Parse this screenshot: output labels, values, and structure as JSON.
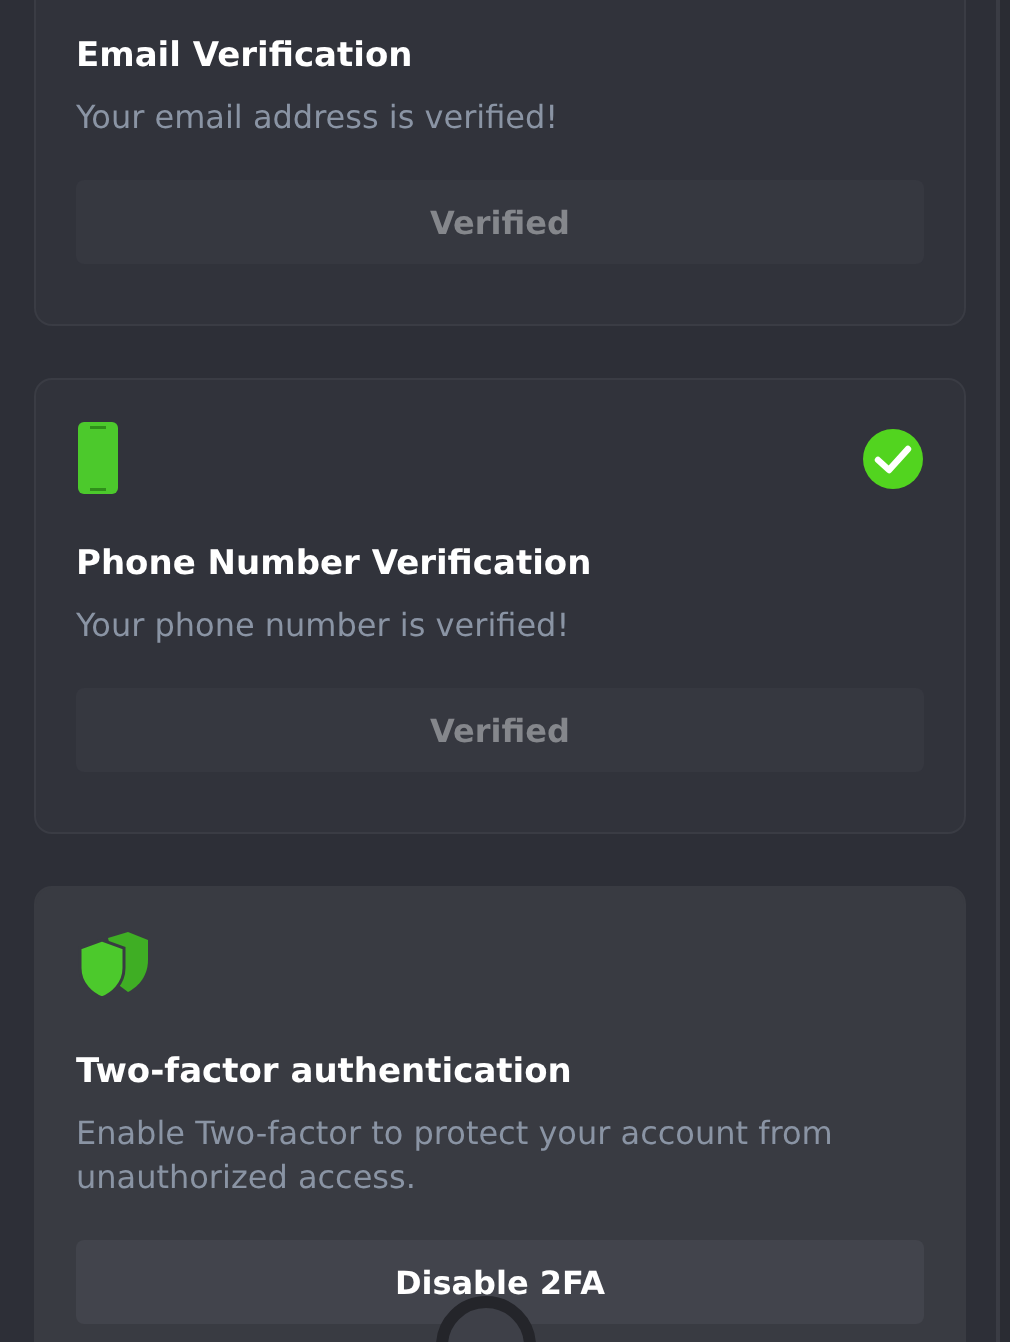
{
  "cards": [
    {
      "title": "Email Verification",
      "description": "Your email address is verified!",
      "button": {
        "label": "Verified",
        "disabled": true
      }
    },
    {
      "kind": "phone",
      "verified": true,
      "title": "Phone Number Verification",
      "description": "Your phone number is verified!",
      "button": {
        "label": "Verified",
        "disabled": true
      }
    },
    {
      "kind": "shield",
      "verified": false,
      "highlighted": true,
      "title": "Two-factor authentication",
      "description": "Enable Two-factor to protect your account from unauthorized access.",
      "button": {
        "label": "Disable 2FA",
        "disabled": false
      }
    }
  ]
}
